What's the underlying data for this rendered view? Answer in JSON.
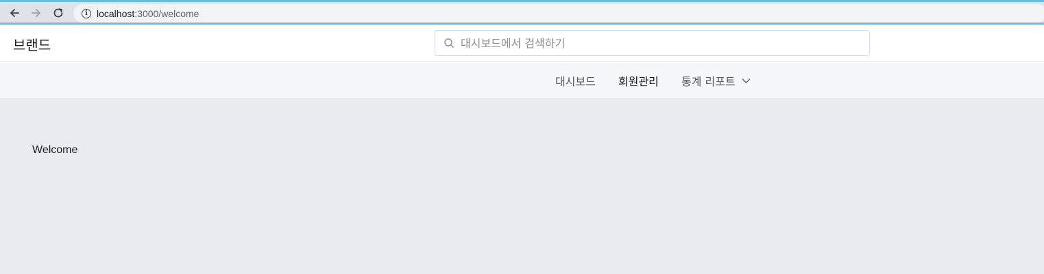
{
  "browser": {
    "url_host": "localhost",
    "url_path": ":3000/welcome",
    "icons": [
      "back-arrow-icon",
      "forward-arrow-icon",
      "reload-icon",
      "info-icon"
    ]
  },
  "header": {
    "brand": "브랜드",
    "search_placeholder": "대시보드에서 검색하기",
    "search_icon": "search-icon"
  },
  "menu": {
    "items": [
      {
        "label": "대시보드",
        "active": false
      },
      {
        "label": "회원관리",
        "active": true
      },
      {
        "label": "통계 리포트",
        "active": false,
        "has_dropdown": true
      }
    ]
  },
  "main": {
    "welcome_text": "Welcome"
  },
  "colors": {
    "browser_accent": "#6cbbe0",
    "page_background": "#eaebf0",
    "menu_background": "#f6f7f9"
  }
}
